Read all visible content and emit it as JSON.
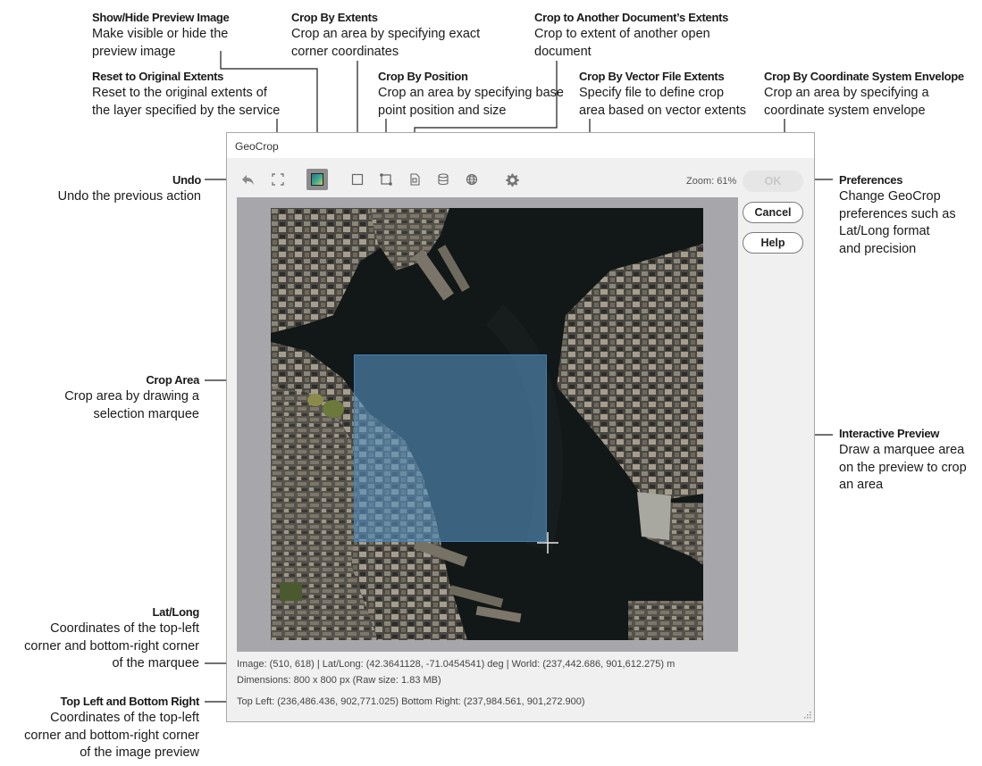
{
  "annotations": {
    "show_hide": {
      "title": "Show/Hide Preview Image",
      "desc1": "Make visible or hide the",
      "desc2": "preview image"
    },
    "reset": {
      "title": "Reset to Original Extents",
      "desc1": "Reset to the original extents of",
      "desc2": "the layer specified by the service"
    },
    "crop_extents": {
      "title": "Crop By Extents",
      "desc1": "Crop an area by specifying exact",
      "desc2": "corner coordinates"
    },
    "crop_position": {
      "title": "Crop By Position",
      "desc1": "Crop an area by specifying base",
      "desc2": "point position and size"
    },
    "crop_document": {
      "title": "Crop to Another Document’s Extents",
      "desc1": "Crop to extent of another open",
      "desc2": "document"
    },
    "crop_vector": {
      "title": "Crop By Vector File Extents",
      "desc1": "Specify file to define crop",
      "desc2": "area based on vector extents"
    },
    "crop_envelope": {
      "title": "Crop By Coordinate System Envelope",
      "desc1": "Crop an area by specifying a",
      "desc2": "coordinate system envelope"
    },
    "undo": {
      "title": "Undo",
      "desc1": "Undo the previous action"
    },
    "preferences": {
      "title": "Preferences",
      "desc1": "Change GeoCrop",
      "desc2": "preferences such as",
      "desc3": "Lat/Long format",
      "desc4": "and precision"
    },
    "crop_area": {
      "title": "Crop Area",
      "desc1": "Crop area by drawing a",
      "desc2": "selection marquee"
    },
    "interactive": {
      "title": "Interactive Preview",
      "desc1": "Draw a marquee area",
      "desc2": "on the preview to crop",
      "desc3": "an area"
    },
    "latlong": {
      "title": "Lat/Long",
      "desc1": "Coordinates of the top-left",
      "desc2": "corner and bottom-right corner",
      "desc3": "of the marquee"
    },
    "topleft": {
      "title": "Top Left and Bottom Right",
      "desc1": "Coordinates of the top-left",
      "desc2": "corner and bottom-right corner",
      "desc3": "of the image preview"
    }
  },
  "window": {
    "title": "GeoCrop",
    "zoom": "Zoom: 61%",
    "buttons": {
      "ok": "OK",
      "cancel": "Cancel",
      "help": "Help"
    },
    "status": {
      "line1": "Image: (510, 618) | Lat/Long: (42.3641128, -71.0454541) deg | World: (237,442.686, 901,612.275) m",
      "line2": "Dimensions: 800 x 800 px (Raw size: 1.83 MB)",
      "line3": "Top Left: (236,486.436, 902,771.025)   Bottom Right: (237,984.561, 901,272.900)"
    }
  },
  "colors": {
    "marquee": "#5591be",
    "frame": "#a7a7ab",
    "water": "#15191a"
  }
}
